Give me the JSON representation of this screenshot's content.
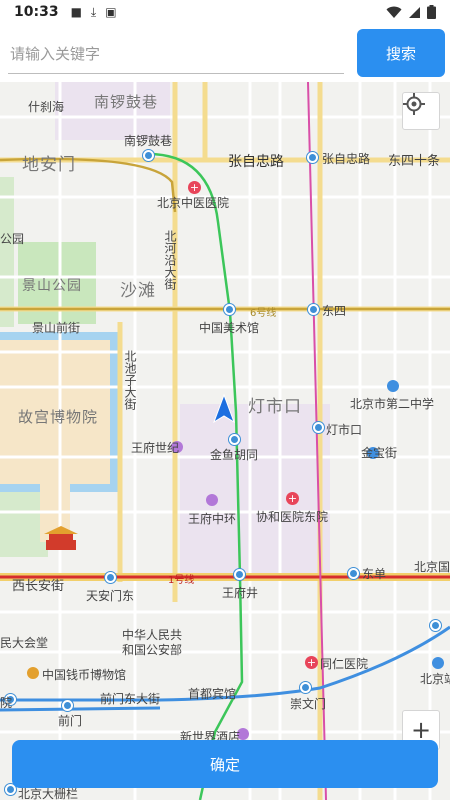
{
  "status_bar": {
    "time": "10:33"
  },
  "search": {
    "placeholder": "请输入关键字",
    "button_label": "搜索"
  },
  "map": {
    "labels": {
      "shichahai": "什刹海",
      "nanluoguxiang_area": "南锣鼓巷",
      "nanluoguxiang_station": "南锣鼓巷",
      "dianmen": "地安门",
      "zhangzizhong_road": "张自忠路",
      "zhangzizhong_station": "张自忠路",
      "dongsishitiao": "东四十条",
      "tcm_hospital": "北京中医医院",
      "gongyuan": "公园",
      "beiheyan": "北河沿大街",
      "jingshan_park": "景山公园",
      "shatan": "沙滩",
      "line6": "6号线",
      "dongsi": "东四",
      "jingshan_qianjie": "景山前街",
      "art_museum": "中国美术馆",
      "beichizi": "北池子大街",
      "palace_museum": "故宫博物院",
      "dengshikou_area": "灯市口",
      "middle_school": "北京市第二中学",
      "dengshikou_station": "灯市口",
      "wangfu_shiji": "王府世纪",
      "jinyu_hutong": "金鱼胡同",
      "jinbao_street": "金宝街",
      "wangfu_zhonghuan": "王府中环",
      "pumc_hospital": "协和医院东院",
      "xichangan": "西长安街",
      "line1": "1号线",
      "dongdan": "东单",
      "beijing_station_area": "北京国",
      "tiananmen_east": "天安门东",
      "wangfujing": "王府井",
      "peoples_hall": "民大会堂",
      "police_ministry_1": "中华人民共",
      "police_ministry_2": "和国公安部",
      "coin_museum": "中国钱币博物馆",
      "tongren_hospital": "同仁医院",
      "beijing_station": "北京站",
      "yuanqu": "院",
      "qianmen_dongdajie": "前门东大街",
      "capital_hotel": "首都宾馆",
      "chongwenmen": "崇文门",
      "qianmen": "前门",
      "new_world_hotel": "新世界酒店",
      "bottom_label": "北京大栅栏"
    },
    "locate_icon": "crosshair-icon",
    "zoom_label": "+"
  },
  "footer": {
    "confirm_label": "确定"
  },
  "colors": {
    "accent": "#2b8ff0",
    "metro_blue": "#3e8fd6",
    "line1": "#d62d2d",
    "line6": "#c8a43a",
    "line5": "#d94fa8",
    "line8": "#3cc65a",
    "line2": "#3f8fe0"
  }
}
